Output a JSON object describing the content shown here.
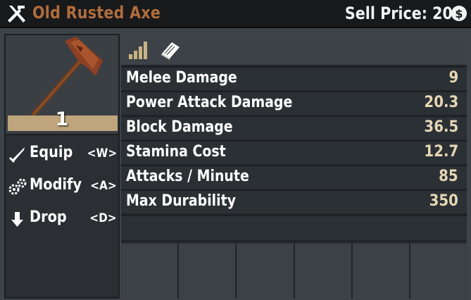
{
  "header": {
    "item_name": "Old Rusted Axe",
    "sell_price_label": "Sell Price: 20",
    "coin_symbol": "$",
    "title_icon": "tools-icon",
    "name_color": "#b16d3a"
  },
  "item": {
    "quantity": "1",
    "image_icon": "rusted-axe-icon"
  },
  "actions": [
    {
      "label": "Equip",
      "key": "<W>",
      "icon": "sword-icon"
    },
    {
      "label": "Modify",
      "key": "<A>",
      "icon": "gears-icon"
    },
    {
      "label": "Drop",
      "key": "<D>",
      "icon": "down-arrow-icon"
    }
  ],
  "info_icons": [
    "quality-bars-icon",
    "book-icon"
  ],
  "stats": [
    {
      "label": "Melee Damage",
      "value": "9"
    },
    {
      "label": "Power Attack Damage",
      "value": "20.3"
    },
    {
      "label": "Block Damage",
      "value": "36.5"
    },
    {
      "label": "Stamina Cost",
      "value": "12.7"
    },
    {
      "label": "Attacks / Minute",
      "value": "85"
    },
    {
      "label": "Max Durability",
      "value": "350"
    }
  ],
  "mod_slot_count": 6,
  "colors": {
    "value_text": "#e6d6b5",
    "quantity_bar": "#bfa57c",
    "quality_icon": "#c8b482"
  }
}
